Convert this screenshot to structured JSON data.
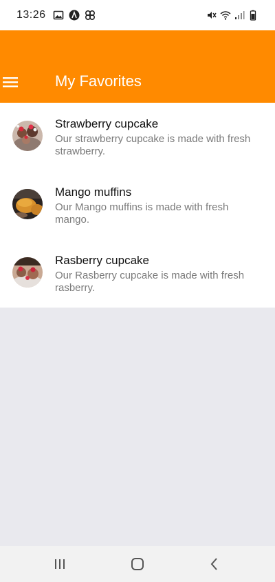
{
  "status_bar": {
    "time": "13:26",
    "left_icons": [
      "image-icon",
      "a-circle-icon",
      "pinwheel-icon"
    ],
    "right_icons": [
      "mute-vibrate-icon",
      "wifi-icon",
      "signal-icon",
      "battery-icon"
    ]
  },
  "app_bar": {
    "title": "My Favorites",
    "color": "#ff8a00",
    "menu_icon": "hamburger-menu-icon"
  },
  "favorites": [
    {
      "title": "Strawberry cupcake",
      "description": "Our strawberry cupcake is made with fresh strawberry."
    },
    {
      "title": "Mango muffins",
      "description": "Our Mango muffins is made with fresh mango."
    },
    {
      "title": "Rasberry cupcake",
      "description": "Our Rasberry cupcake is made with fresh rasberry."
    }
  ],
  "nav_bar": {
    "buttons": [
      "recents-icon",
      "home-icon",
      "back-icon"
    ]
  }
}
